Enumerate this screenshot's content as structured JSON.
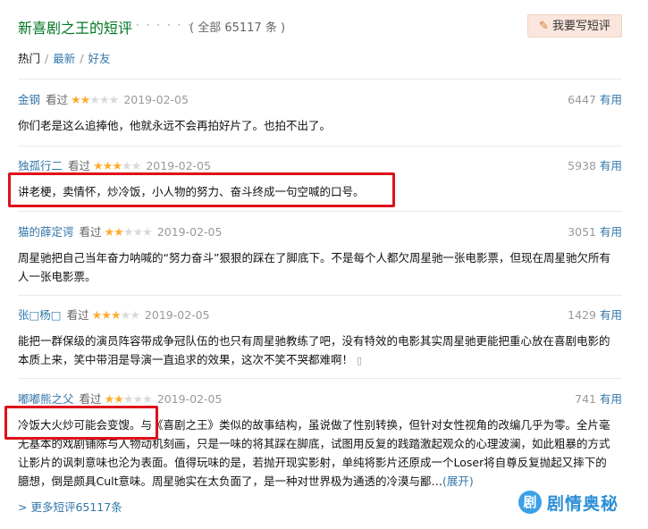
{
  "header": {
    "title": "新喜剧之王的短评",
    "dots": "· · · · · ·",
    "count": "( 全部 65117 条 )",
    "write_button": "我要写短评"
  },
  "tabs": {
    "hot": "热门",
    "latest": "最新",
    "friends": "好友",
    "sep": "/"
  },
  "stars": {
    "on": "★★",
    "off": "★★★"
  },
  "reviews": [
    {
      "user": "金钢",
      "watched": "看过",
      "rating": 2,
      "date": "2019-02-05",
      "useful_count": "6447",
      "useful_label": "有用",
      "content": "你们老是这么追捧他，他就永远不会再拍好片了。也拍不出了。"
    },
    {
      "user": "独孤行二",
      "watched": "看过",
      "rating": 3,
      "date": "2019-02-05",
      "useful_count": "5938",
      "useful_label": "有用",
      "content": "讲老梗，卖情怀，炒冷饭，小人物的努力、奋斗终成一句空喊的口号。"
    },
    {
      "user": "猫的薛定谔",
      "watched": "看过",
      "rating": 2,
      "date": "2019-02-05",
      "useful_count": "3051",
      "useful_label": "有用",
      "content": "周星驰把自己当年奋力呐喊的“努力奋斗”狠狠的踩在了脚底下。不是每个人都欠周星驰一张电影票，但现在周星驰欠所有人一张电影票。"
    },
    {
      "user": "张□杨□",
      "watched": "看过",
      "rating": 3,
      "date": "2019-02-05",
      "useful_count": "1429",
      "useful_label": "有用",
      "content": "能把一群保级的演员阵容带成争冠队伍的也只有周星驰教练了吧，没有特效的电影其实周星驰更能把重心放在喜剧电影的本质上来，笑中带泪是导演一直追求的效果，这次不笑不哭都难啊！"
    },
    {
      "user": "嘟嘟熊之父",
      "watched": "看过",
      "rating": 2,
      "date": "2019-02-05",
      "useful_count": "741",
      "useful_label": "有用",
      "content": "冷饭大火炒可能会变馊。与《喜剧之王》类似的故事结构，虽说做了性别转换，但针对女性视角的改编几乎为零。全片毫无基本的戏剧铺陈与人物动机刻画，只是一味的将其踩在脚底，试图用反复的践踏激起观众的心理波澜，如此粗暴的方式让影片的讽刺意味也沦为表面。值得玩味的是，若抛开现实影射，单纯将影片还原成一个Loser将自尊反复抛起又摔下的臆想，倒是颇具Cult意味。周星驰实在太负面了，是一种对世界极为通透的冷漠与鄙…",
      "expand": "(展开)"
    }
  ],
  "more_link": "> 更多短评65117条",
  "watermark": {
    "logo_char": "剧",
    "text": "剧情奥秘"
  },
  "colors": {
    "accent": "#007722",
    "link": "#3377aa",
    "star": "#ffac2d",
    "highlight": "#e0101a"
  }
}
